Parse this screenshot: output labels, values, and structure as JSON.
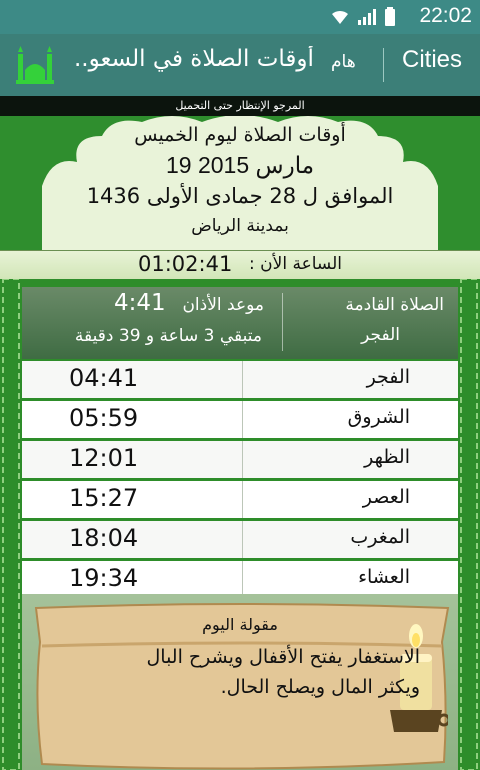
{
  "status_bar": {
    "time": "22:02",
    "icons": [
      "wifi-icon",
      "signal-icon",
      "battery-icon"
    ]
  },
  "action_bar": {
    "app_title": "أوقات الصلاة في السعو..",
    "ham_label": "هام",
    "cities_label": "Cities"
  },
  "loading_text": "المرجو الإنتظار حتى التحميل",
  "header": {
    "day_line": "أوقات الصلاة ليوم الخميس",
    "gregorian_date": "19 مارس 2015",
    "hijri_date": "الموافق ل 28 جمادى الأولى 1436",
    "city_line": "بمدينة الرياض"
  },
  "now": {
    "label": "الساعة الأن :",
    "time": "01:02:41"
  },
  "next_prayer": {
    "label": "الصلاة القادمة",
    "name": "الفجر",
    "adhan_label": "موعد الأذان",
    "adhan_time": "4:41",
    "remaining": "متبقي 3 ساعة و 39 دقيقة"
  },
  "prayers": [
    {
      "name": "الفجر",
      "time": "04:41"
    },
    {
      "name": "الشروق",
      "time": "05:59"
    },
    {
      "name": "الظهر",
      "time": "12:01"
    },
    {
      "name": "العصر",
      "time": "15:27"
    },
    {
      "name": "المغرب",
      "time": "18:04"
    },
    {
      "name": "العشاء",
      "time": "19:34"
    }
  ],
  "quote": {
    "title": "مقولة اليوم",
    "text": "الاستغفار يفتح الأقفال ويشرح البال ويكثر المال ويصلح الحال."
  },
  "colors": {
    "status_bar": "#3d8a86",
    "action_bar": "#3c7f78",
    "main_green": "#2e8d2a",
    "row_bg": "#f7f8f6"
  }
}
